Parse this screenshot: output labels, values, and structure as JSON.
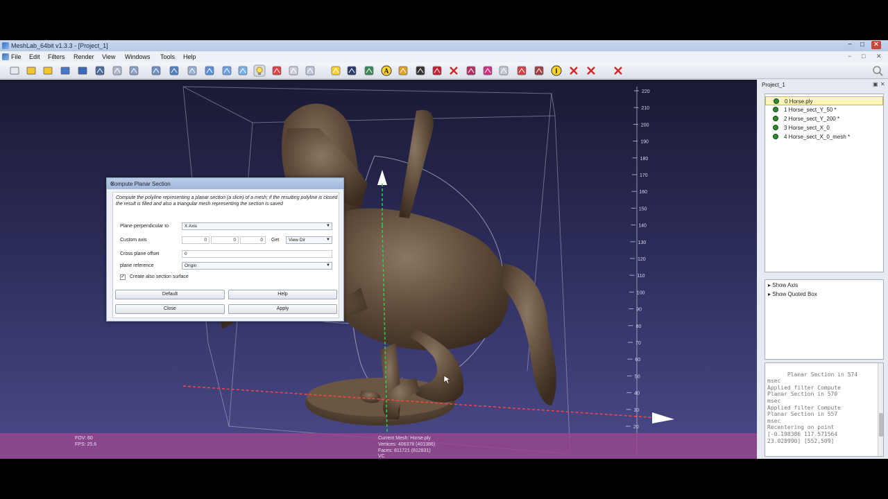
{
  "window": {
    "title": "MeshLab_64bit v1.3.3 - [Project_1]",
    "controls": [
      "−",
      "□",
      "✕"
    ]
  },
  "menu": {
    "items": [
      "File",
      "Edit",
      "Filters",
      "Render",
      "View",
      "Windows",
      "Tools",
      "Help"
    ],
    "mdi_controls": [
      "−",
      "□",
      "✕"
    ]
  },
  "toolbar": {
    "icons": [
      "new-project-icon",
      "open-project-icon",
      "save-project-icon",
      "reload-icon",
      "import-mesh-icon",
      "snapshot-icon",
      "bbox-icon",
      "points-icon",
      "wireframe-icon",
      "hidden-lines-icon",
      "flat-lines-icon",
      "flat-icon",
      "smooth-icon",
      "texture-icon",
      "lighting-icon",
      "double-side-icon",
      "fancy-light-icon",
      "back-face-icon",
      "manipulator-icon",
      "select-vertex-icon",
      "pick-points-icon",
      "measure-icon",
      "align-icon",
      "paint-icon",
      "zoom-icon",
      "delete-face-icon",
      "select-face-icon",
      "select-connected-icon",
      "z-painting-icon",
      "quality-icon",
      "noise-icon",
      "info-icon",
      "delete-vert-icon",
      "delete-selected-icon",
      "delete-all-icon"
    ]
  },
  "viewport": {
    "axis_ticks": [
      "220",
      "210",
      "200",
      "190",
      "180",
      "170",
      "160",
      "150",
      "140",
      "130",
      "120",
      "110",
      "100",
      "90",
      "80",
      "70",
      "60",
      "50",
      "40",
      "30",
      "20"
    ],
    "status_left": {
      "fov": "FOV: 60",
      "fps": "FPS:   25.6"
    },
    "status_center": {
      "mesh": "Current Mesh: Horse.ply",
      "vertices": "Vertices: 406378 (401386)",
      "faces": "Faces: 811721 (812831)",
      "extra": "VC"
    }
  },
  "dialog": {
    "title": "Compute Planar Section",
    "close": "✕",
    "description": "Compute the polyline representing a planar section (a slice) of a mesh; if the resulting polyline is closed the result is filled and also a triangular mesh representing the section is saved",
    "plane_label": "Plane perpendicular to",
    "plane_value": "X Axis",
    "custom_axis_label": "Custom axis",
    "custom_axis_values": [
      "0",
      "0",
      "0"
    ],
    "get_label": "Get",
    "get_value": "View Dir",
    "offset_label": "Cross plane offset",
    "offset_value": "0",
    "reference_label": "plane reference",
    "reference_value": "Origin",
    "checkbox_label": "Create also section surface",
    "checkbox_mark": "✓",
    "buttons": {
      "default": "Default",
      "help": "Help",
      "close": "Close",
      "apply": "Apply"
    }
  },
  "project": {
    "title": "Project_1",
    "layers": [
      {
        "label": "0  Horse.ply",
        "selected": true
      },
      {
        "label": "1  Horse_sect_Y_50 *",
        "selected": false
      },
      {
        "label": "2  Horse_sect_Y_200 *",
        "selected": false
      },
      {
        "label": "3  Horse_sect_X_0",
        "selected": false
      },
      {
        "label": "4  Horse_sect_X_0_mesh *",
        "selected": false
      }
    ],
    "decorations": [
      "Show Axis",
      "Show Quoted Box"
    ],
    "log": "Planar Section in 574\nmsec\nApplied filter Compute\nPlanar Section in 570\nmsec\nApplied filter Compute\nPlanar Section in 557\nmsec\nRecentering on point\n[-0.198386 117.571564\n23.028990] [552,509]"
  },
  "colors": {
    "background_top": "#1a1a33",
    "background_bottom": "#4a4a8a",
    "status_band": "#964690",
    "mesh": "#5e4a38",
    "axis_y": "#33cc55",
    "axis_x": "#ff4444"
  }
}
